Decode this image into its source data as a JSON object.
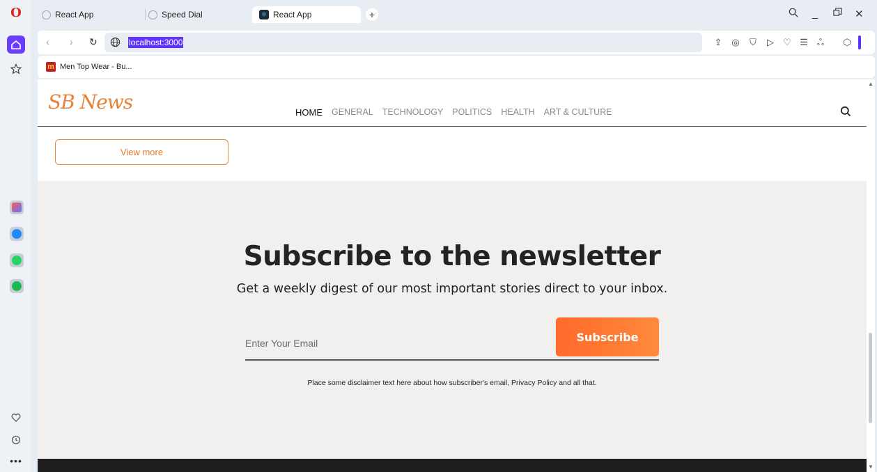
{
  "browser": {
    "tabs": [
      {
        "label": "React App"
      },
      {
        "label": "Speed Dial"
      },
      {
        "label": "React App"
      }
    ],
    "url": "localhost:3000",
    "bookmark": "Men Top Wear - Bu...",
    "bookmark_icon_letter": "m"
  },
  "site": {
    "logo": "SB News",
    "menu": [
      "HOME",
      "GENERAL",
      "TECHNOLOGY",
      "POLITICS",
      "HEALTH",
      "ART & CULTURE"
    ],
    "view_more": "View more"
  },
  "newsletter": {
    "title": "Subscribe to the newsletter",
    "subtitle": "Get a weekly digest of our most important stories direct to your inbox.",
    "email_placeholder": "Enter Your Email",
    "button": "Subscribe",
    "disclaimer": "Place some disclaimer text here about how subscriber's email, Privacy Policy and all that."
  },
  "colors": {
    "accent": "#ff7433",
    "opera_purple": "#5f33ff",
    "footer": "#1f1f1f"
  }
}
